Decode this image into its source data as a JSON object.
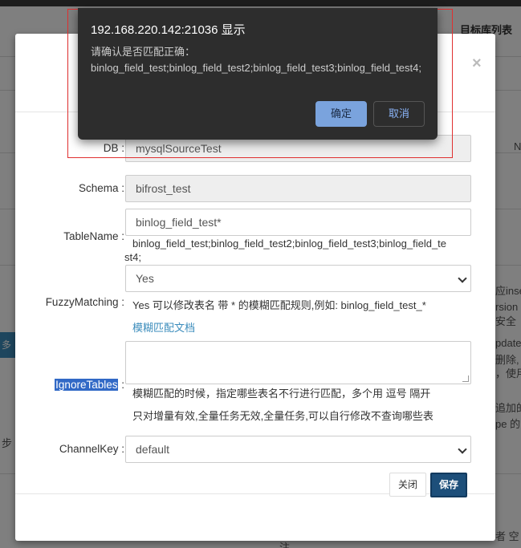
{
  "background": {
    "target_list_title": "目标库列表",
    "fragments": [
      "N",
      "应inse",
      "rsion 的",
      "安全",
      "pdate,",
      "删除,",
      "，使用",
      "追加的",
      "pe 的",
      "者 空",
      "步",
      "多表",
      "注"
    ]
  },
  "modal": {
    "close_glyph": "×",
    "fields": {
      "db": {
        "label": "DB",
        "value": "mysqlSourceTest"
      },
      "schema": {
        "label": "Schema",
        "value": "bifrost_test"
      },
      "table_name": {
        "label": "TableName",
        "value": "binlog_field_test*",
        "help": "binlog_field_test;binlog_field_test2;binlog_field_test3;binlog_field_test4;"
      },
      "fuzzy_matching": {
        "label": "FuzzyMatching",
        "selected": "Yes",
        "help": "Yes 可以修改表名 带 * 的模糊匹配规则,例如: binlog_field_test_*",
        "doc_link": "模糊匹配文档"
      },
      "ignore_tables": {
        "label": "IgnoreTables",
        "help_1": "模糊匹配的时候，指定哪些表名不行进行匹配，多个用 逗号 隔开",
        "help_2": "只对增量有效,全量任务无效,全量任务,可以自行修改不查询哪些表"
      },
      "channel_key": {
        "label": "ChannelKey",
        "selected": "default"
      }
    },
    "footer": {
      "close_label": "关闭",
      "save_label": "保存"
    }
  },
  "confirm_dialog": {
    "title": "192.168.220.142:21036 显示",
    "message_line1": "请确认是否匹配正确：",
    "message_line2": "binlog_field_test;binlog_field_test2;binlog_field_test3;binlog_field_test4;",
    "ok_label": "确定",
    "cancel_label": "取消"
  },
  "colors": {
    "primary_button": "#1d4f7a",
    "confirm_ok": "#7aa3dd",
    "highlight": "#3169c6",
    "link": "#3c8dbc"
  }
}
